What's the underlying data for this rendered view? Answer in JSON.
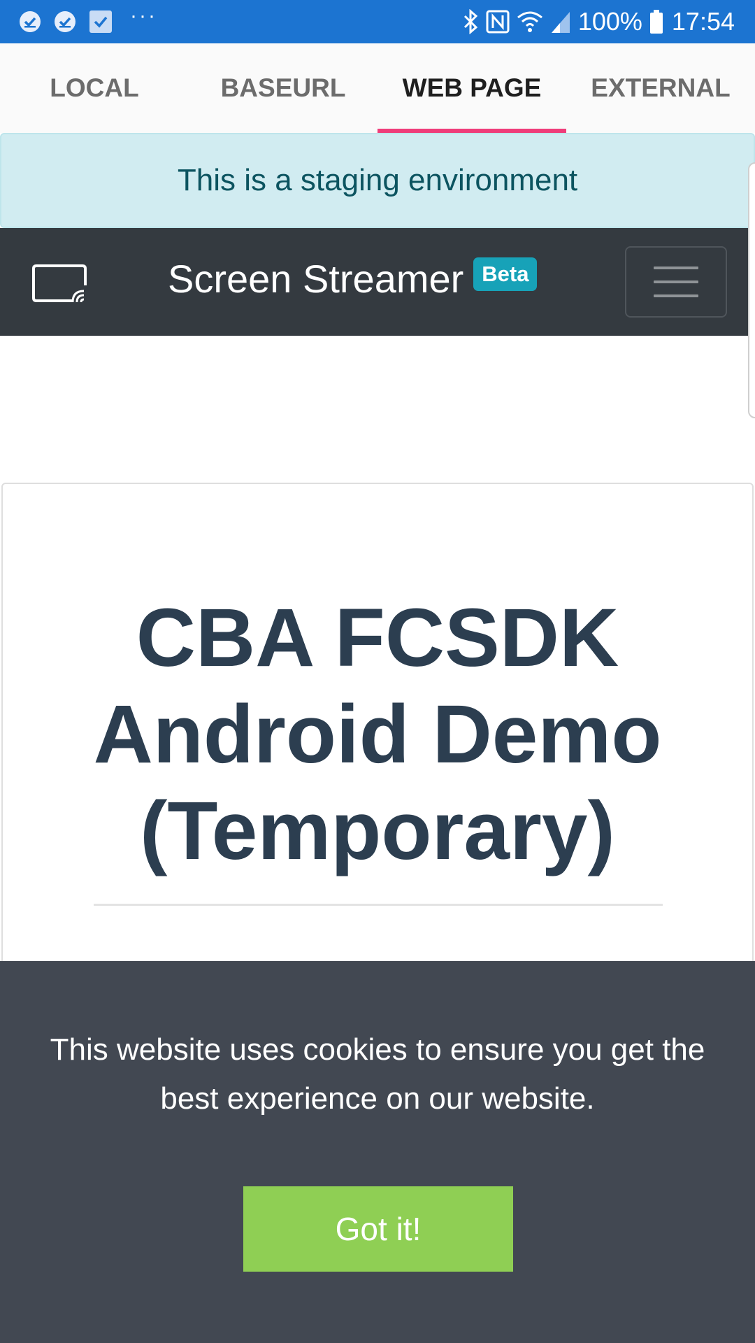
{
  "status_bar": {
    "battery": "100%",
    "time": "17:54",
    "dots": "···"
  },
  "tabs": [
    {
      "label": "LOCAL",
      "active": false
    },
    {
      "label": "BASEURL",
      "active": false
    },
    {
      "label": "WEB PAGE",
      "active": true
    },
    {
      "label": "EXTERNAL",
      "active": false
    }
  ],
  "banner": {
    "text": "This is a staging environment"
  },
  "navbar": {
    "brand": "Screen Streamer",
    "badge": "Beta",
    "icon": "cast-icon",
    "menu_icon": "hamburger-menu-icon"
  },
  "card": {
    "title": "CBA FCSDK Android Demo (Temporary)"
  },
  "cookie": {
    "message": "This website uses cookies to ensure you get the best experience on our website.",
    "button": "Got it!"
  },
  "colors": {
    "status_bar": "#1c74d1",
    "tab_indicator": "#ef3d7a",
    "banner_bg": "#d1ecf1",
    "navbar_bg": "#343a40",
    "badge_bg": "#17a2b8",
    "title": "#2c3e50",
    "cookie_bg": "#424852",
    "cookie_button": "#8fcf54"
  }
}
